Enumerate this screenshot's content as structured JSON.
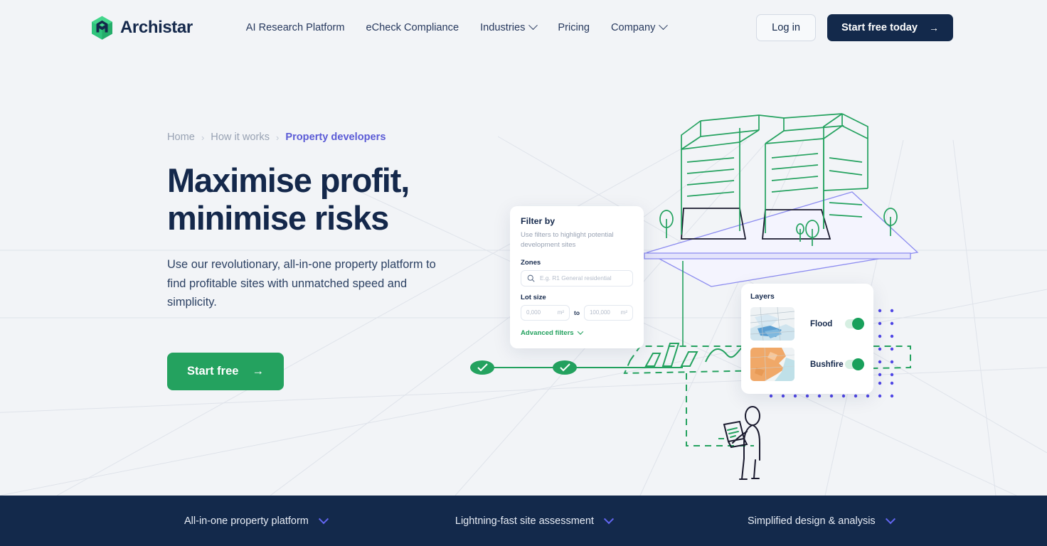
{
  "header": {
    "brand_name": "Archistar",
    "logo_icon": "archistar-hexagon-logo",
    "nav": [
      {
        "label": "AI Research Platform",
        "has_chevron": false
      },
      {
        "label": "eCheck Compliance",
        "has_chevron": false
      },
      {
        "label": "Industries",
        "has_chevron": true
      },
      {
        "label": "Pricing",
        "has_chevron": false
      },
      {
        "label": "Company",
        "has_chevron": true
      }
    ],
    "login_label": "Log in",
    "cta_label": "Start free today",
    "cta_arrow": "→"
  },
  "hero": {
    "breadcrumb": [
      {
        "label": "Home",
        "active": false
      },
      {
        "label": "How it works",
        "active": false
      },
      {
        "label": "Property developers",
        "active": true
      }
    ],
    "breadcrumb_separator": "›",
    "title_line1": "Maximise profit,",
    "title_line2": "minimise risks",
    "subtitle": "Use our revolutionary, all-in-one property platform to find profitable sites with unmatched speed and simplicity.",
    "cta_label": "Start free",
    "cta_arrow": "→"
  },
  "filter_card": {
    "title": "Filter by",
    "description": "Use filters to highlight potential development sites",
    "zones_label": "Zones",
    "zones_placeholder": "E.g. R1 General residential",
    "search_icon": "search-icon",
    "lot_size_label": "Lot size",
    "lot_min_value": "0,000",
    "lot_min_unit": "m²",
    "lot_separator": "to",
    "lot_max_value": "100,000",
    "lot_max_unit": "m²",
    "advanced_filters_label": "Advanced filters",
    "advanced_chevron_icon": "chevron-down-icon"
  },
  "layers_card": {
    "title": "Layers",
    "layers": [
      {
        "name": "Flood",
        "thumbnail": "flood-map-thumbnail",
        "enabled": true
      },
      {
        "name": "Bushfire",
        "thumbnail": "bushfire-map-thumbnail",
        "enabled": true
      }
    ]
  },
  "bottom_bar": {
    "items": [
      {
        "label": "All-in-one property platform",
        "chevron_icon": "chevron-down-icon"
      },
      {
        "label": "Lightning-fast site assessment",
        "chevron_icon": "chevron-down-icon"
      },
      {
        "label": "Simplified design & analysis",
        "chevron_icon": "chevron-down-icon"
      }
    ]
  },
  "colors": {
    "page_background": "#f2f4f7",
    "brand_navy": "#14284b",
    "brand_green": "#24a25f",
    "accent_indigo": "#5b5bd6",
    "bottom_bar_bg": "#13294b",
    "muted_text": "#98a2b3"
  }
}
